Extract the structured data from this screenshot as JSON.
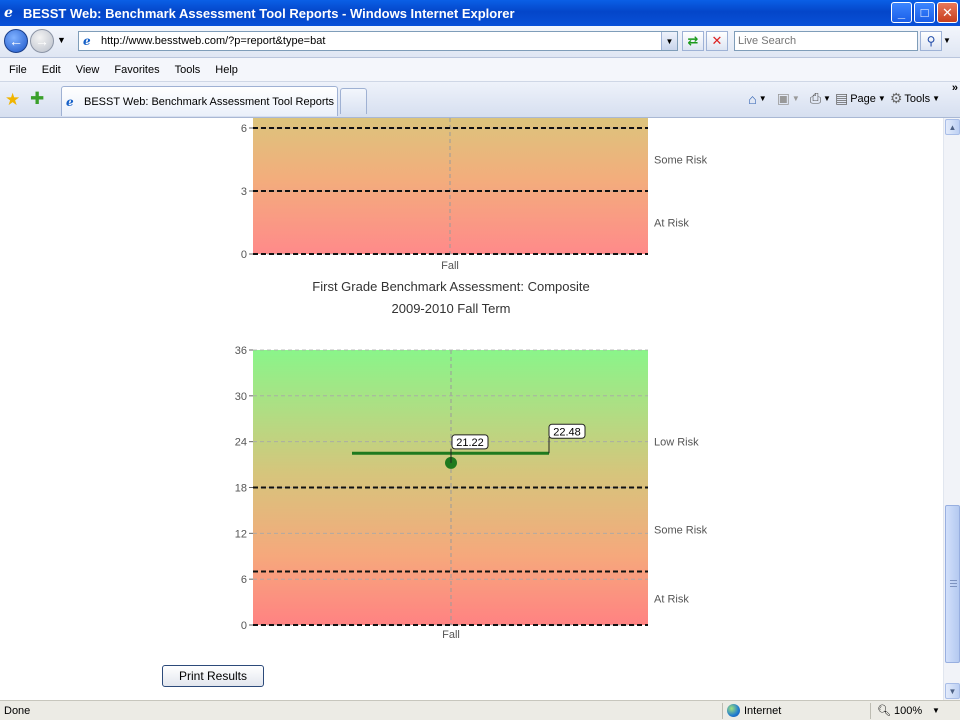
{
  "window": {
    "title": "BESST Web: Benchmark Assessment Tool Reports - Windows Internet Explorer",
    "buttons": {
      "minimize": "_",
      "maximize": "□",
      "close": "✕"
    }
  },
  "address_bar": {
    "url": "http://www.besstweb.com/?p=report&type=bat",
    "search_placeholder": "Live Search"
  },
  "menu": [
    "File",
    "Edit",
    "View",
    "Favorites",
    "Tools",
    "Help"
  ],
  "tabs": [
    {
      "label": "BESST Web: Benchmark Assessment Tool Reports",
      "active": true
    }
  ],
  "command_bar": {
    "page_label": "Page",
    "tools_label": "Tools"
  },
  "report": {
    "print_button": "Print Results"
  },
  "chart_data": [
    {
      "type": "line",
      "partial": true,
      "categories": [
        "Fall"
      ],
      "y_ticks": [
        0,
        3,
        6
      ],
      "ylim": [
        0,
        7
      ],
      "grid": true,
      "thresholds": [
        0,
        3,
        6
      ],
      "zones": [
        "At Risk",
        "Some Risk"
      ],
      "background_colors": {
        "top": "#e0c27a",
        "bottom": "#ff8a8a"
      }
    },
    {
      "type": "line",
      "title": "First Grade Benchmark Assessment: Composite",
      "subtitle": "2009-2010 Fall Term",
      "categories": [
        "Fall"
      ],
      "y_ticks": [
        0,
        6,
        12,
        18,
        24,
        30,
        36
      ],
      "ylim": [
        0,
        36
      ],
      "grid": true,
      "thresholds": [
        0,
        7,
        18
      ],
      "zones": [
        "At Risk",
        "Some Risk",
        "Low Risk"
      ],
      "score": {
        "category": "Fall",
        "value": 21.22,
        "label": "21.22"
      },
      "benchmark": {
        "value": 22.48,
        "label": "22.48"
      },
      "colors": {
        "score": "#1e7a1e",
        "top": "#8af58a",
        "bottom": "#ff8080"
      }
    }
  ],
  "status_bar": {
    "status": "Done",
    "zone": "Internet",
    "zoom": "100%"
  }
}
